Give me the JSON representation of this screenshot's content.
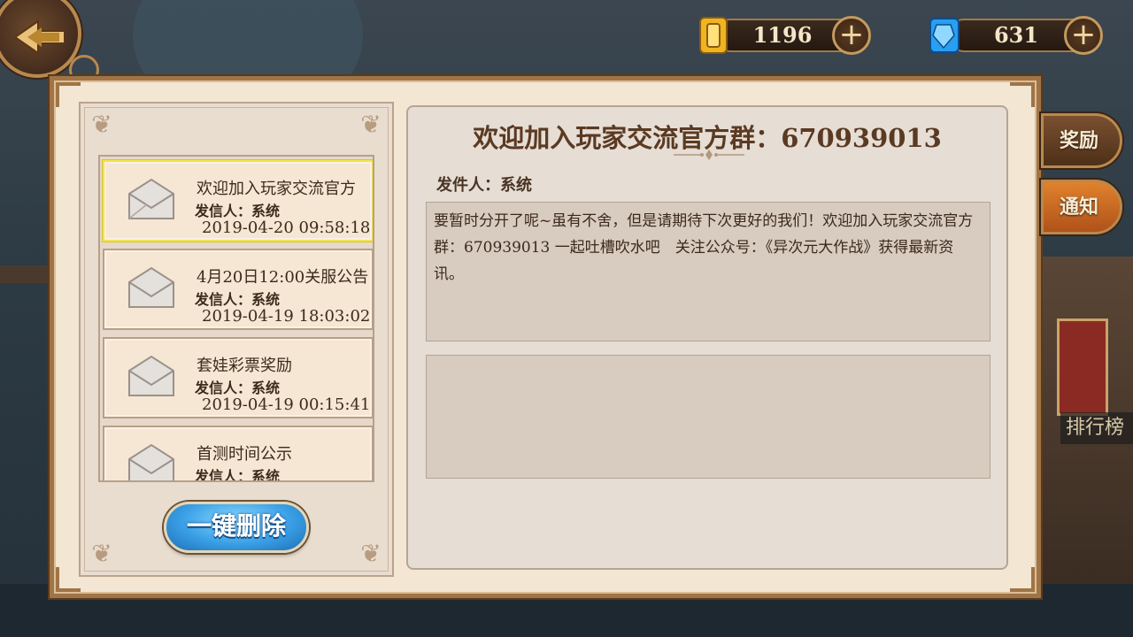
{
  "header": {
    "back_icon": "back-arrow-icon",
    "gold": {
      "icon": "gold-coin-icon",
      "amount": "1196",
      "plus_label": "+"
    },
    "gem": {
      "icon": "blue-gem-icon",
      "amount": "631",
      "plus_label": "+"
    }
  },
  "mail_list": {
    "items": [
      {
        "title": "欢迎加入玩家交流官方",
        "sender": "发信人：系统",
        "date": "2019-04-20 09:58:18",
        "selected": true
      },
      {
        "title": "4月20日12:00关服公告",
        "sender": "发信人：系统",
        "date": "2019-04-19 18:03:02"
      },
      {
        "title": "套娃彩票奖励",
        "sender": "发信人：系统",
        "date": "2019-04-19 00:15:41"
      },
      {
        "title": "首测时间公示",
        "sender": "发信人：系统",
        "date": ""
      }
    ],
    "delete_all_label": "一键删除"
  },
  "detail": {
    "title": "欢迎加入玩家交流官方群：670939013",
    "sender": "发件人：系统",
    "content": "要暂时分开了呢~虽有不舍，但是请期待下次更好的我们！欢迎加入玩家交流官方群：670939013 一起吐槽吹水吧　关注公众号：《异次元大作战》获得最新资讯。"
  },
  "side_tabs": {
    "reward": "奖励",
    "notice": "通知"
  },
  "background": {
    "rank_label": "排行榜"
  },
  "colors": {
    "panel_bg": "#f3e6d2",
    "frame": "#a07446",
    "selected_border": "#f2e44a",
    "delete_button": "#3aa0e6",
    "notice_tab": "#e0822c"
  }
}
